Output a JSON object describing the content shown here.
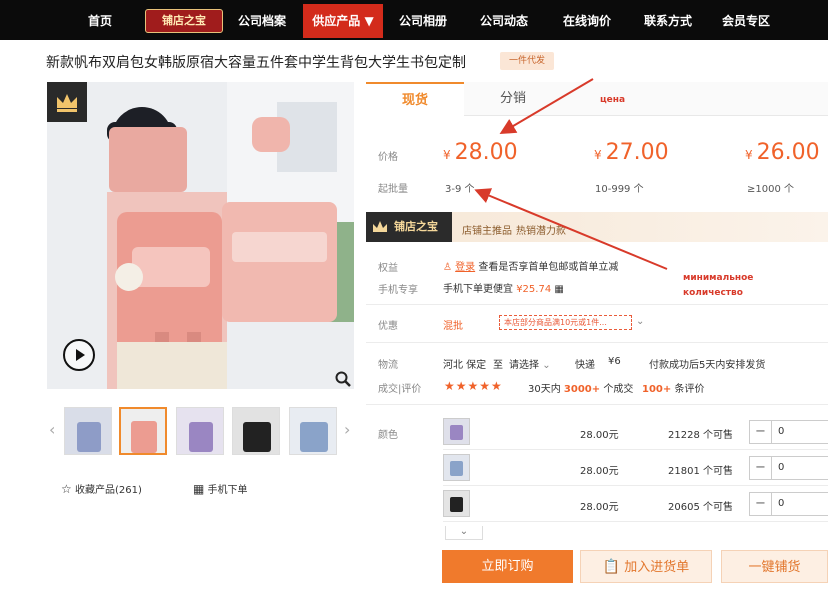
{
  "nav": {
    "items": [
      "首页",
      "公司档案",
      "公司相册",
      "公司动态",
      "在线询价",
      "联系方式",
      "会员专区"
    ],
    "badge": "铺店之宝",
    "active": "供应产品 ▼"
  },
  "product": {
    "title": "新款帆布双肩包女韩版原宿大容量五件套中学生背包大学生书包定制",
    "tag": "一件代发"
  },
  "gallery": {
    "fav": "收藏产品(261)",
    "mobile_order": "手机下单"
  },
  "tabs": {
    "active": "现货",
    "second": "分销"
  },
  "annotations": {
    "price_note": "цена",
    "min_note_1": "минимальное",
    "min_note_2": "количество"
  },
  "pricing": {
    "price_label": "价格",
    "moq_label": "起批量",
    "yen": "¥",
    "tiers": [
      {
        "price": "28.00",
        "range": "3-9 个"
      },
      {
        "price": "27.00",
        "range": "10-999 个"
      },
      {
        "price": "26.00",
        "range": "≥1000 个"
      }
    ]
  },
  "brand": {
    "logo": "铺店之宝",
    "text1": "店铺主推品",
    "text2": "热销潜力款"
  },
  "rows": {
    "benefit_label": "权益",
    "benefit_link": "登录",
    "benefit_text": "查看是否享首单包邮或首单立减",
    "mobile_label": "手机专享",
    "mobile_text": "手机下单更便宜",
    "mobile_price": "¥25.74",
    "promo_label": "优惠",
    "promo_type": "混批",
    "coupon_text": "本店部分商品满10元或1件...",
    "logistics_label": "物流",
    "from": "河北 保定",
    "to_prefix": "至",
    "to_select": "请选择",
    "express": "快递",
    "express_fee": "¥6",
    "ship_note": "付款成功后5天内安排发货",
    "review_label": "成交|评价",
    "stars": "★★★★★",
    "deals_prefix": "30天内",
    "deals_count": "3000+",
    "deals_suffix": "个成交",
    "reviews_count": "100+",
    "reviews_suffix": "条评价"
  },
  "colors": {
    "label": "颜色",
    "items": [
      {
        "price": "28.00元",
        "stock": "21228 个可售",
        "qty": "0"
      },
      {
        "price": "28.00元",
        "stock": "21801 个可售",
        "qty": "0"
      },
      {
        "price": "28.00元",
        "stock": "20605 个可售",
        "qty": "0"
      }
    ],
    "expand": "⌄"
  },
  "actions": {
    "buy": "立即订购",
    "cart": "加入进货单",
    "one_click": "一键铺货"
  },
  "theme": {
    "accent": "#f0622a",
    "nav_bg": "#0b0b0b",
    "nav_active": "#d32b1b",
    "annotation": "#d83a2a"
  }
}
